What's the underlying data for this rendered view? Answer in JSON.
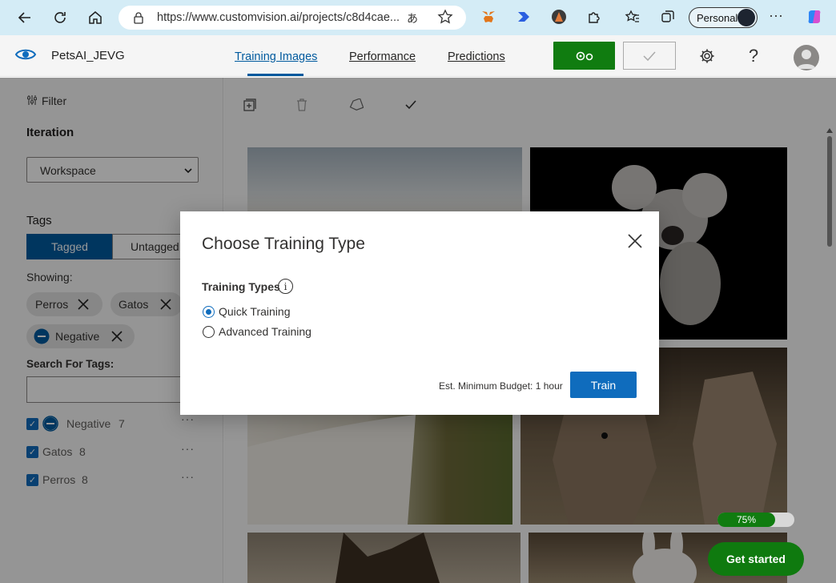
{
  "browser": {
    "url": "https://www.customvision.ai/projects/c8d4cae...",
    "profile_label": "Personal"
  },
  "app": {
    "project_name": "PetsAI_JEVG",
    "tabs": [
      {
        "label": "Training Images",
        "active": true
      },
      {
        "label": "Performance",
        "active": false
      },
      {
        "label": "Predictions",
        "active": false
      }
    ]
  },
  "sidebar": {
    "filter_label": "Filter",
    "iteration_heading": "Iteration",
    "iteration_value": "Workspace",
    "tags_heading": "Tags",
    "toggle_tagged": "Tagged",
    "toggle_untagged": "Untagged",
    "showing_label": "Showing:",
    "chips": [
      "Perros",
      "Gatos",
      "Negative"
    ],
    "search_label": "Search For Tags:",
    "tag_list": [
      {
        "name": "Negative",
        "count": "7"
      },
      {
        "name": "Gatos",
        "count": "8"
      },
      {
        "name": "Perros",
        "count": "8"
      }
    ]
  },
  "main": {
    "progress_label": "75%",
    "progress_fraction": 0.75,
    "get_started_label": "Get started"
  },
  "dialog": {
    "title": "Choose Training Type",
    "types_label": "Training Types",
    "options": [
      {
        "label": "Quick Training",
        "selected": true
      },
      {
        "label": "Advanced Training",
        "selected": false
      }
    ],
    "budget_text": "Est. Minimum Budget: 1 hour",
    "train_label": "Train"
  },
  "colors": {
    "accent": "#0f6cbd",
    "train_green": "#107c10",
    "browser_bar": "#d4ecf6"
  }
}
